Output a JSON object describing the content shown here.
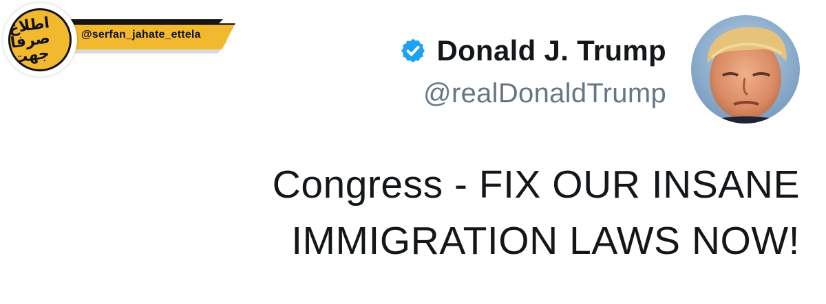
{
  "watermark": {
    "handle": "@serfan_jahate_ettela",
    "logo_text": "اطلاع صرفا جهت",
    "accent_color": "#f2b82e"
  },
  "tweet": {
    "display_name": "Donald J. Trump",
    "handle": "@realDonaldTrump",
    "verified": true,
    "verified_color": "#1da1f2",
    "avatar_icon": "profile-photo",
    "text_line_1": "Congress - FIX OUR INSANE",
    "text_line_2": "IMMIGRATION LAWS NOW!"
  }
}
